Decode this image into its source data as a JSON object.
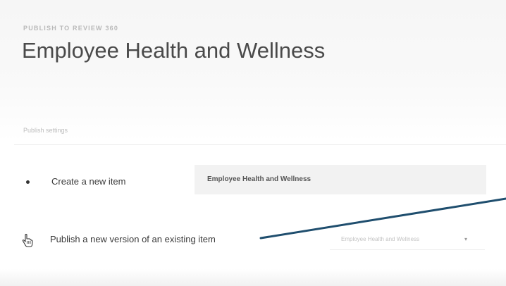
{
  "header": {
    "eyebrow": "PUBLISH TO REVIEW 360",
    "title": "Employee Health and Wellness"
  },
  "publish_settings": {
    "section_label": "Publish settings",
    "options": [
      {
        "label": "Create a new item",
        "selected": true,
        "input_value": "Employee Health and Wellness"
      },
      {
        "label": "Publish a new version of an existing item",
        "selected": false,
        "select_value": "Employee Health and Wellness"
      }
    ]
  },
  "icons": {
    "select_chevron": "▾",
    "cursor": "hand-pointer-icon"
  },
  "colors": {
    "callout_line": "#1f4e6e",
    "input_background": "#f2f2f2",
    "title_text": "#4a4a4a"
  }
}
